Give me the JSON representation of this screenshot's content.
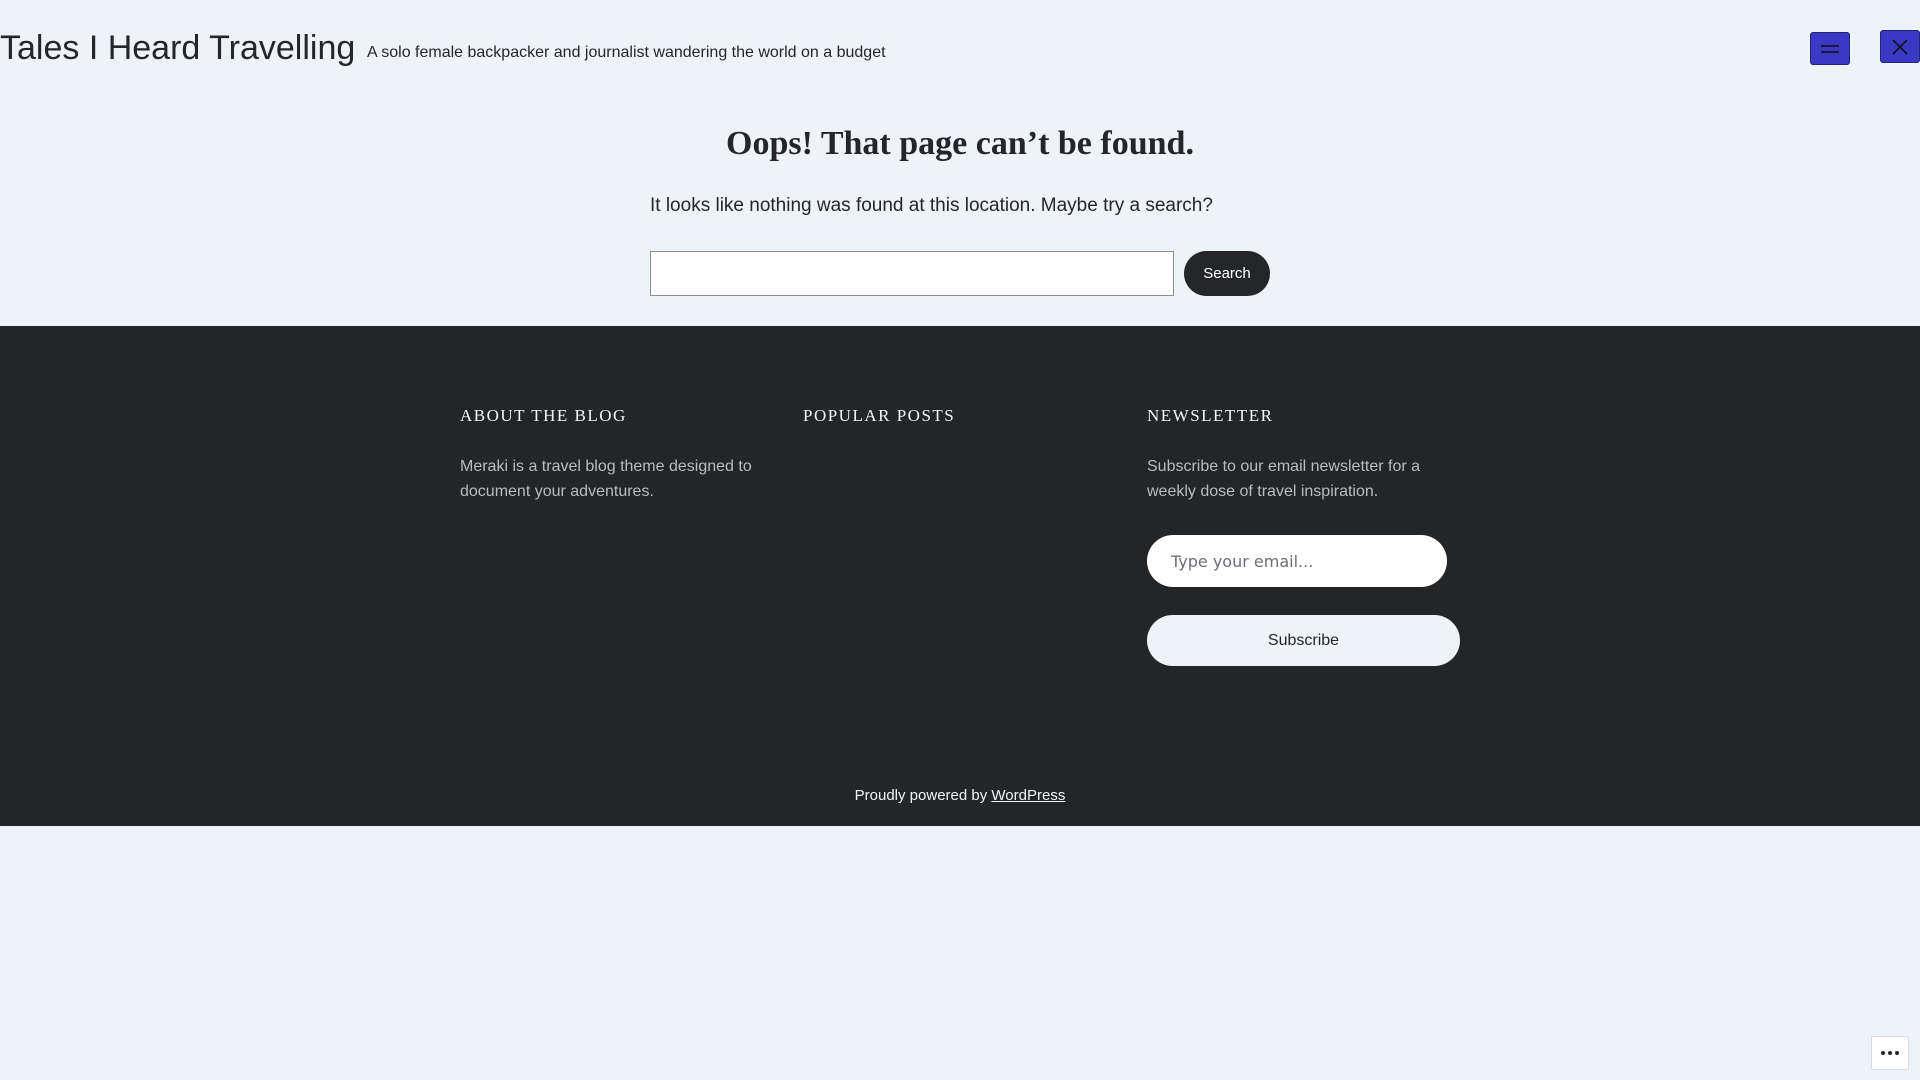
{
  "header": {
    "site_title": "Tales I Heard Travelling",
    "tagline": "A solo female backpacker and journalist wandering the world on a budget",
    "menu_icon": "hamburger-icon",
    "close_icon": "close-icon",
    "accent_color": "#3a38c4"
  },
  "main": {
    "title": "Oops! That page can’t be found.",
    "message": "It looks like nothing was found at this location. Maybe try a search?",
    "search": {
      "value": "",
      "placeholder": "",
      "button_label": "Search"
    }
  },
  "footer": {
    "background": "#242527",
    "about": {
      "heading": "ABOUT THE BLOG",
      "text": "Meraki is a travel blog theme designed to document your adventures."
    },
    "popular": {
      "heading": "POPULAR POSTS"
    },
    "newsletter": {
      "heading": "NEWSLETTER",
      "text": "Subscribe to our email newsletter for a weekly dose of travel inspiration.",
      "email_placeholder": "Type your email...",
      "button_label": "Subscribe"
    },
    "credit": {
      "prefix": "Proudly powered by",
      "link_label": "WordPress"
    }
  },
  "widget": {
    "more_icon": "ellipsis-icon"
  }
}
